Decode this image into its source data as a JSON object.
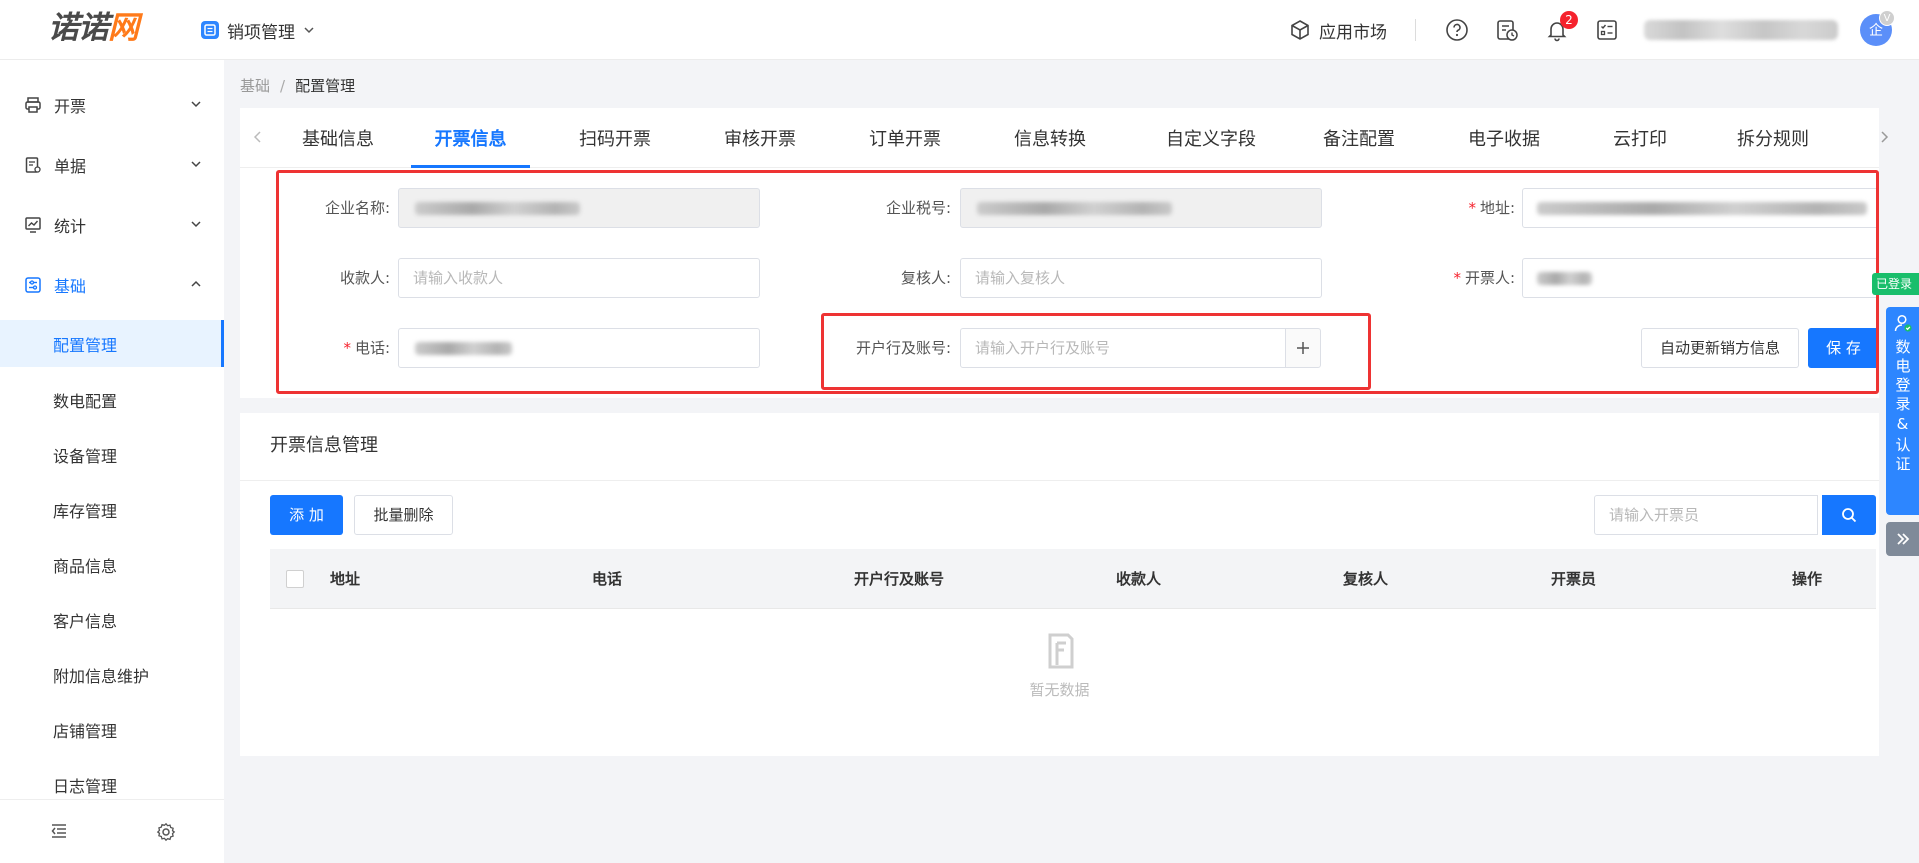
{
  "brand": {
    "logo_main": "诺诺",
    "logo_accent": "网"
  },
  "header": {
    "app_name": "销项管理",
    "market": "应用市场",
    "notification_count": "2",
    "avatar": "企",
    "avatar_badge": "V"
  },
  "sidebar": {
    "groups": [
      {
        "label": "开票"
      },
      {
        "label": "单据"
      },
      {
        "label": "统计"
      },
      {
        "label": "基础"
      }
    ],
    "sub_items": [
      "配置管理",
      "数电配置",
      "设备管理",
      "库存管理",
      "商品信息",
      "客户信息",
      "附加信息维护",
      "店铺管理",
      "日志管理"
    ]
  },
  "breadcrumb": {
    "root": "基础",
    "sep": "/",
    "current": "配置管理"
  },
  "tabs": [
    "基础信息",
    "开票信息",
    "扫码开票",
    "审核开票",
    "订单开票",
    "信息转换",
    "自定义字段",
    "备注配置",
    "电子收据",
    "云打印",
    "拆分规则"
  ],
  "form": {
    "company_name_label": "企业名称:",
    "tax_no_label": "企业税号:",
    "address_label": "地址:",
    "payee_label": "收款人:",
    "payee_placeholder": "请输入收款人",
    "reviewer_label": "复核人:",
    "reviewer_placeholder": "请输入复核人",
    "drawer_label": "开票人:",
    "phone_label": "电话:",
    "bank_label": "开户行及账号:",
    "bank_placeholder": "请输入开户行及账号",
    "required_mark": "*",
    "auto_update_button": "自动更新销方信息",
    "save_button": "保 存"
  },
  "management": {
    "title": "开票信息管理",
    "add_button": "添 加",
    "batch_delete_button": "批量删除",
    "search_placeholder": "请输入开票员",
    "columns": [
      "地址",
      "电话",
      "开户行及账号",
      "收款人",
      "复核人",
      "开票员",
      "操作"
    ],
    "empty_text": "暂无数据"
  },
  "float": {
    "green_label": "已登录",
    "blue_label": "数电登录&认证"
  },
  "colors": {
    "primary": "#1677ff",
    "brand_orange": "#ff7a1a",
    "required": "#f5222d",
    "highlight_box": "#ee3333"
  }
}
